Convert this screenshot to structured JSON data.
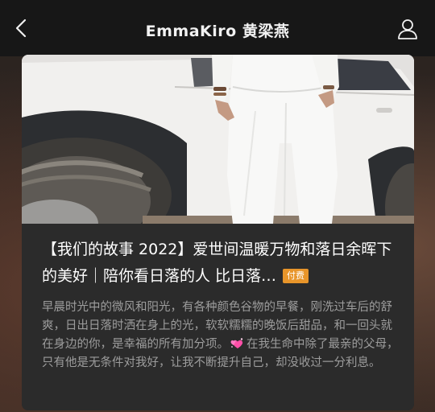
{
  "nav": {
    "back_icon": "chevron-left-icon",
    "title": "EmmaKiro 黄梁燕",
    "profile_icon": "person-icon"
  },
  "card": {
    "cover_image": "woman in white pants beside white car",
    "title": "【我们的故事 2022】爱世间温暖万物和落日余晖下的美好｜陪你看日落的人 比日落…",
    "badge": "付费",
    "description_before": "早晨时光中的微风和阳光，有各种颜色谷物的早餐，刚洗过车后的舒爽，日出日落时洒在身上的光，软软糯糯的晚饭后甜品，和一回头就在身边的你，是幸福的所有加分项。",
    "description_icon": "sparkling-hearts-icon",
    "description_after": "在我生命中除了最亲的父母，只有他是无条件对我好，让我不断提升自己，却没收过一分利息。"
  },
  "colors": {
    "topbar": "#171717",
    "card_body": "#2b2b2b",
    "badge": "#e8952a",
    "description": "#9d9d9d"
  }
}
